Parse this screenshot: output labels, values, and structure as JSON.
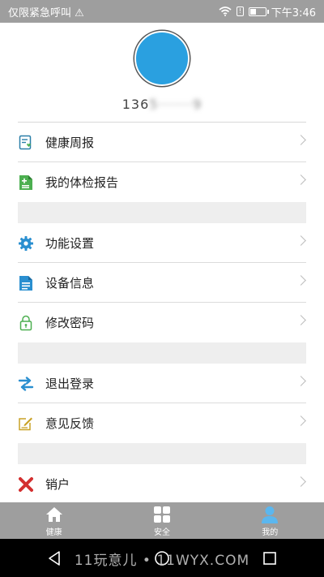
{
  "status_bar": {
    "carrier": "仅限紧急呼叫",
    "warning_icon": "⚠",
    "time": "下午3:46",
    "battery_fraction": 0.35,
    "signal_glyph": "!"
  },
  "profile": {
    "avatar_color": "#2aa0e0",
    "phone_visible": "136",
    "phone_masked": "5·······9"
  },
  "menu": {
    "weekly_report": "健康周报",
    "checkup_report": "我的体检报告",
    "settings": "功能设置",
    "device_info": "设备信息",
    "change_password": "修改密码",
    "logout": "退出登录",
    "feedback": "意见反馈",
    "close_account": "销户"
  },
  "tabs": {
    "health": "健康",
    "safety": "安全",
    "mine": "我的"
  },
  "watermark": "11玩意儿 • 11WYX.COM",
  "colors": {
    "accent": "#2aa0e0",
    "tab_active": "#5bb7ef",
    "green": "#4caf50",
    "red": "#d32f2f",
    "yellow": "#c9a227"
  }
}
